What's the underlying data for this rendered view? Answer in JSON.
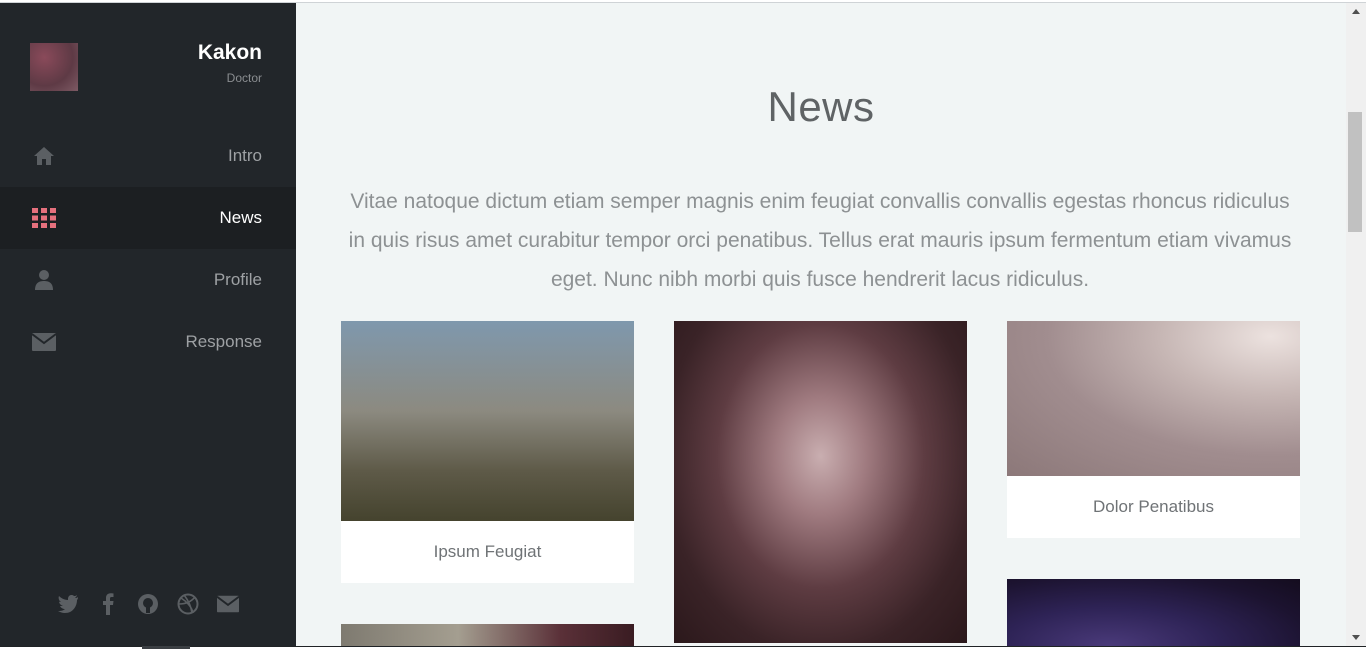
{
  "profile": {
    "name": "Kakon",
    "role": "Doctor"
  },
  "nav": [
    {
      "label": "Intro",
      "icon": "home-icon",
      "active": false
    },
    {
      "label": "News",
      "icon": "grid-icon",
      "active": true
    },
    {
      "label": "Profile",
      "icon": "user-icon",
      "active": false
    },
    {
      "label": "Response",
      "icon": "envelope-icon",
      "active": false
    }
  ],
  "social_icons": [
    "twitter-icon",
    "facebook-icon",
    "github-icon",
    "dribbble-icon",
    "email-icon"
  ],
  "main": {
    "title": "News",
    "intro": "Vitae natoque dictum etiam semper magnis enim feugiat convallis convallis egestas rhoncus ridiculus in quis risus amet curabitur tempor orci penatibus. Tellus erat mauris ipsum fermentum etiam vivamus eget. Nunc nibh morbi quis fusce hendrerit lacus ridiculus."
  },
  "cards": [
    {
      "caption": "Ipsum Feugiat"
    },
    {
      "caption": ""
    },
    {
      "caption": "Dolor Penatibus"
    },
    {
      "caption": ""
    },
    {
      "caption": ""
    }
  ],
  "colors": {
    "accent": "#e5707d",
    "sidebar_bg": "#22262a",
    "main_bg": "#f1f5f5"
  }
}
